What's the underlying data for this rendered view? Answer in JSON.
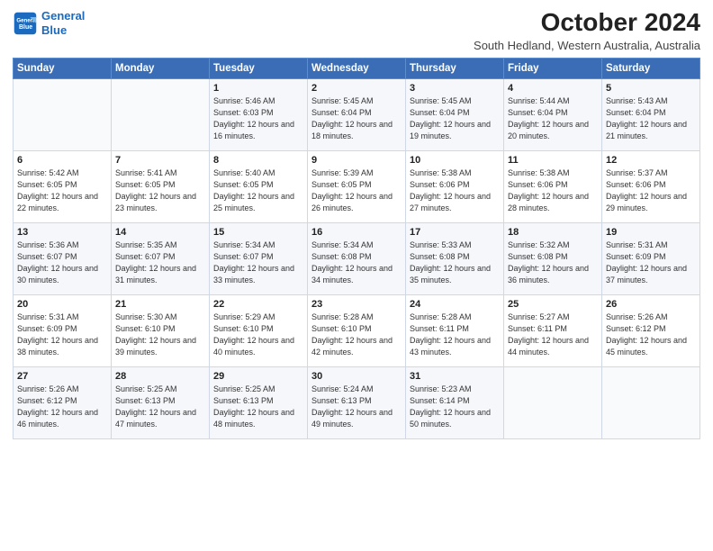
{
  "header": {
    "logo_line1": "General",
    "logo_line2": "Blue",
    "month": "October 2024",
    "location": "South Hedland, Western Australia, Australia"
  },
  "days_of_week": [
    "Sunday",
    "Monday",
    "Tuesday",
    "Wednesday",
    "Thursday",
    "Friday",
    "Saturday"
  ],
  "weeks": [
    [
      {
        "day": "",
        "info": ""
      },
      {
        "day": "",
        "info": ""
      },
      {
        "day": "1",
        "info": "Sunrise: 5:46 AM\nSunset: 6:03 PM\nDaylight: 12 hours and 16 minutes."
      },
      {
        "day": "2",
        "info": "Sunrise: 5:45 AM\nSunset: 6:04 PM\nDaylight: 12 hours and 18 minutes."
      },
      {
        "day": "3",
        "info": "Sunrise: 5:45 AM\nSunset: 6:04 PM\nDaylight: 12 hours and 19 minutes."
      },
      {
        "day": "4",
        "info": "Sunrise: 5:44 AM\nSunset: 6:04 PM\nDaylight: 12 hours and 20 minutes."
      },
      {
        "day": "5",
        "info": "Sunrise: 5:43 AM\nSunset: 6:04 PM\nDaylight: 12 hours and 21 minutes."
      }
    ],
    [
      {
        "day": "6",
        "info": "Sunrise: 5:42 AM\nSunset: 6:05 PM\nDaylight: 12 hours and 22 minutes."
      },
      {
        "day": "7",
        "info": "Sunrise: 5:41 AM\nSunset: 6:05 PM\nDaylight: 12 hours and 23 minutes."
      },
      {
        "day": "8",
        "info": "Sunrise: 5:40 AM\nSunset: 6:05 PM\nDaylight: 12 hours and 25 minutes."
      },
      {
        "day": "9",
        "info": "Sunrise: 5:39 AM\nSunset: 6:05 PM\nDaylight: 12 hours and 26 minutes."
      },
      {
        "day": "10",
        "info": "Sunrise: 5:38 AM\nSunset: 6:06 PM\nDaylight: 12 hours and 27 minutes."
      },
      {
        "day": "11",
        "info": "Sunrise: 5:38 AM\nSunset: 6:06 PM\nDaylight: 12 hours and 28 minutes."
      },
      {
        "day": "12",
        "info": "Sunrise: 5:37 AM\nSunset: 6:06 PM\nDaylight: 12 hours and 29 minutes."
      }
    ],
    [
      {
        "day": "13",
        "info": "Sunrise: 5:36 AM\nSunset: 6:07 PM\nDaylight: 12 hours and 30 minutes."
      },
      {
        "day": "14",
        "info": "Sunrise: 5:35 AM\nSunset: 6:07 PM\nDaylight: 12 hours and 31 minutes."
      },
      {
        "day": "15",
        "info": "Sunrise: 5:34 AM\nSunset: 6:07 PM\nDaylight: 12 hours and 33 minutes."
      },
      {
        "day": "16",
        "info": "Sunrise: 5:34 AM\nSunset: 6:08 PM\nDaylight: 12 hours and 34 minutes."
      },
      {
        "day": "17",
        "info": "Sunrise: 5:33 AM\nSunset: 6:08 PM\nDaylight: 12 hours and 35 minutes."
      },
      {
        "day": "18",
        "info": "Sunrise: 5:32 AM\nSunset: 6:08 PM\nDaylight: 12 hours and 36 minutes."
      },
      {
        "day": "19",
        "info": "Sunrise: 5:31 AM\nSunset: 6:09 PM\nDaylight: 12 hours and 37 minutes."
      }
    ],
    [
      {
        "day": "20",
        "info": "Sunrise: 5:31 AM\nSunset: 6:09 PM\nDaylight: 12 hours and 38 minutes."
      },
      {
        "day": "21",
        "info": "Sunrise: 5:30 AM\nSunset: 6:10 PM\nDaylight: 12 hours and 39 minutes."
      },
      {
        "day": "22",
        "info": "Sunrise: 5:29 AM\nSunset: 6:10 PM\nDaylight: 12 hours and 40 minutes."
      },
      {
        "day": "23",
        "info": "Sunrise: 5:28 AM\nSunset: 6:10 PM\nDaylight: 12 hours and 42 minutes."
      },
      {
        "day": "24",
        "info": "Sunrise: 5:28 AM\nSunset: 6:11 PM\nDaylight: 12 hours and 43 minutes."
      },
      {
        "day": "25",
        "info": "Sunrise: 5:27 AM\nSunset: 6:11 PM\nDaylight: 12 hours and 44 minutes."
      },
      {
        "day": "26",
        "info": "Sunrise: 5:26 AM\nSunset: 6:12 PM\nDaylight: 12 hours and 45 minutes."
      }
    ],
    [
      {
        "day": "27",
        "info": "Sunrise: 5:26 AM\nSunset: 6:12 PM\nDaylight: 12 hours and 46 minutes."
      },
      {
        "day": "28",
        "info": "Sunrise: 5:25 AM\nSunset: 6:13 PM\nDaylight: 12 hours and 47 minutes."
      },
      {
        "day": "29",
        "info": "Sunrise: 5:25 AM\nSunset: 6:13 PM\nDaylight: 12 hours and 48 minutes."
      },
      {
        "day": "30",
        "info": "Sunrise: 5:24 AM\nSunset: 6:13 PM\nDaylight: 12 hours and 49 minutes."
      },
      {
        "day": "31",
        "info": "Sunrise: 5:23 AM\nSunset: 6:14 PM\nDaylight: 12 hours and 50 minutes."
      },
      {
        "day": "",
        "info": ""
      },
      {
        "day": "",
        "info": ""
      }
    ]
  ]
}
